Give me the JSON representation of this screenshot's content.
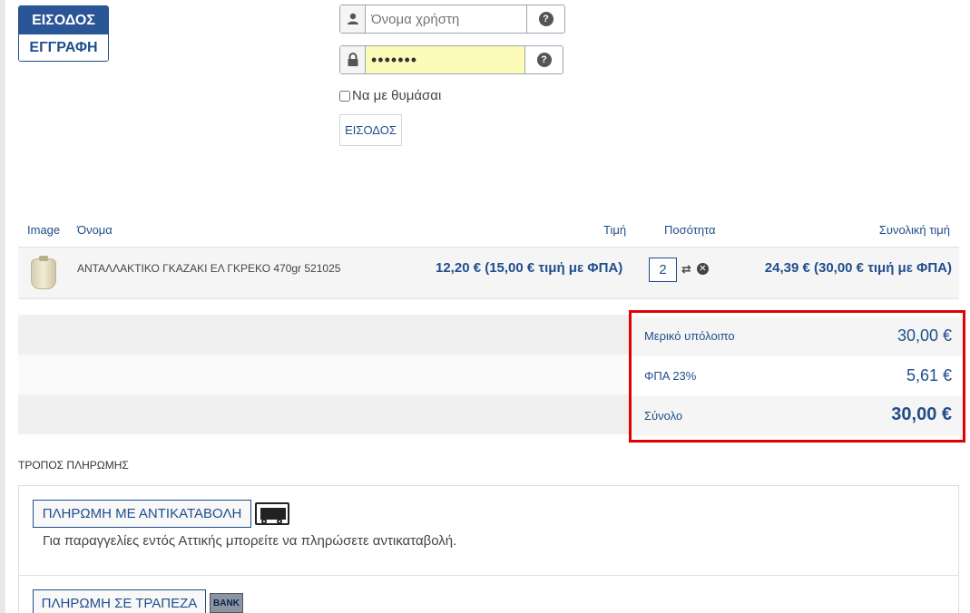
{
  "auth_tabs": {
    "login_label": "ΕΙΣΟΔΟΣ",
    "register_label": "ΕΓΓΡΑΦΗ"
  },
  "login_form": {
    "username_placeholder": "Όνομα χρήστη",
    "password_value": "•••••••",
    "help_glyph": "?",
    "remember_label": "Να με θυμάσαι",
    "submit_label": "ΕΙΣΟΔΟΣ"
  },
  "cart": {
    "headers": {
      "image": "Image",
      "name": "Όνομα",
      "price": "Τιμή",
      "quantity": "Ποσότητα",
      "total": "Συνολική τιμή"
    },
    "items": [
      {
        "name": "ΑΝΤΑΛΛΑΚΤΙΚΟ ΓΚΑΖΑΚΙ ΕΛ ΓΚΡΕΚΟ 470gr 521025",
        "price": "12,20 € (15,00 € τιμή με ΦΠΑ)",
        "quantity": "2",
        "total": "24,39 € (30,00 € τιμή με ΦΠΑ)"
      }
    ]
  },
  "totals": [
    {
      "label": "Μερικό υπόλοιπο",
      "value": "30,00 €"
    },
    {
      "label": "ΦΠΑ 23%",
      "value": "5,61 €"
    },
    {
      "label": "Σύνολο",
      "value": "30,00 €"
    }
  ],
  "payment": {
    "title": "ΤΡΟΠΟΣ ΠΛΗΡΩΜΗΣ",
    "cod_label": "ΠΛΗΡΩΜΗ ΜΕ ΑΝΤΙΚΑΤΑΒΟΛΗ",
    "cod_note": "Για παραγγελίες εντός Αττικής μπορείτε να πληρώσετε αντικαταβολή.",
    "bank_label": "ΠΛΗΡΩΜΗ ΣΕ ΤΡΑΠΕΖΑ",
    "bank_icon_text": "BANK"
  },
  "colors": {
    "accent": "#1f4e8c",
    "highlight_border": "#e30000"
  }
}
